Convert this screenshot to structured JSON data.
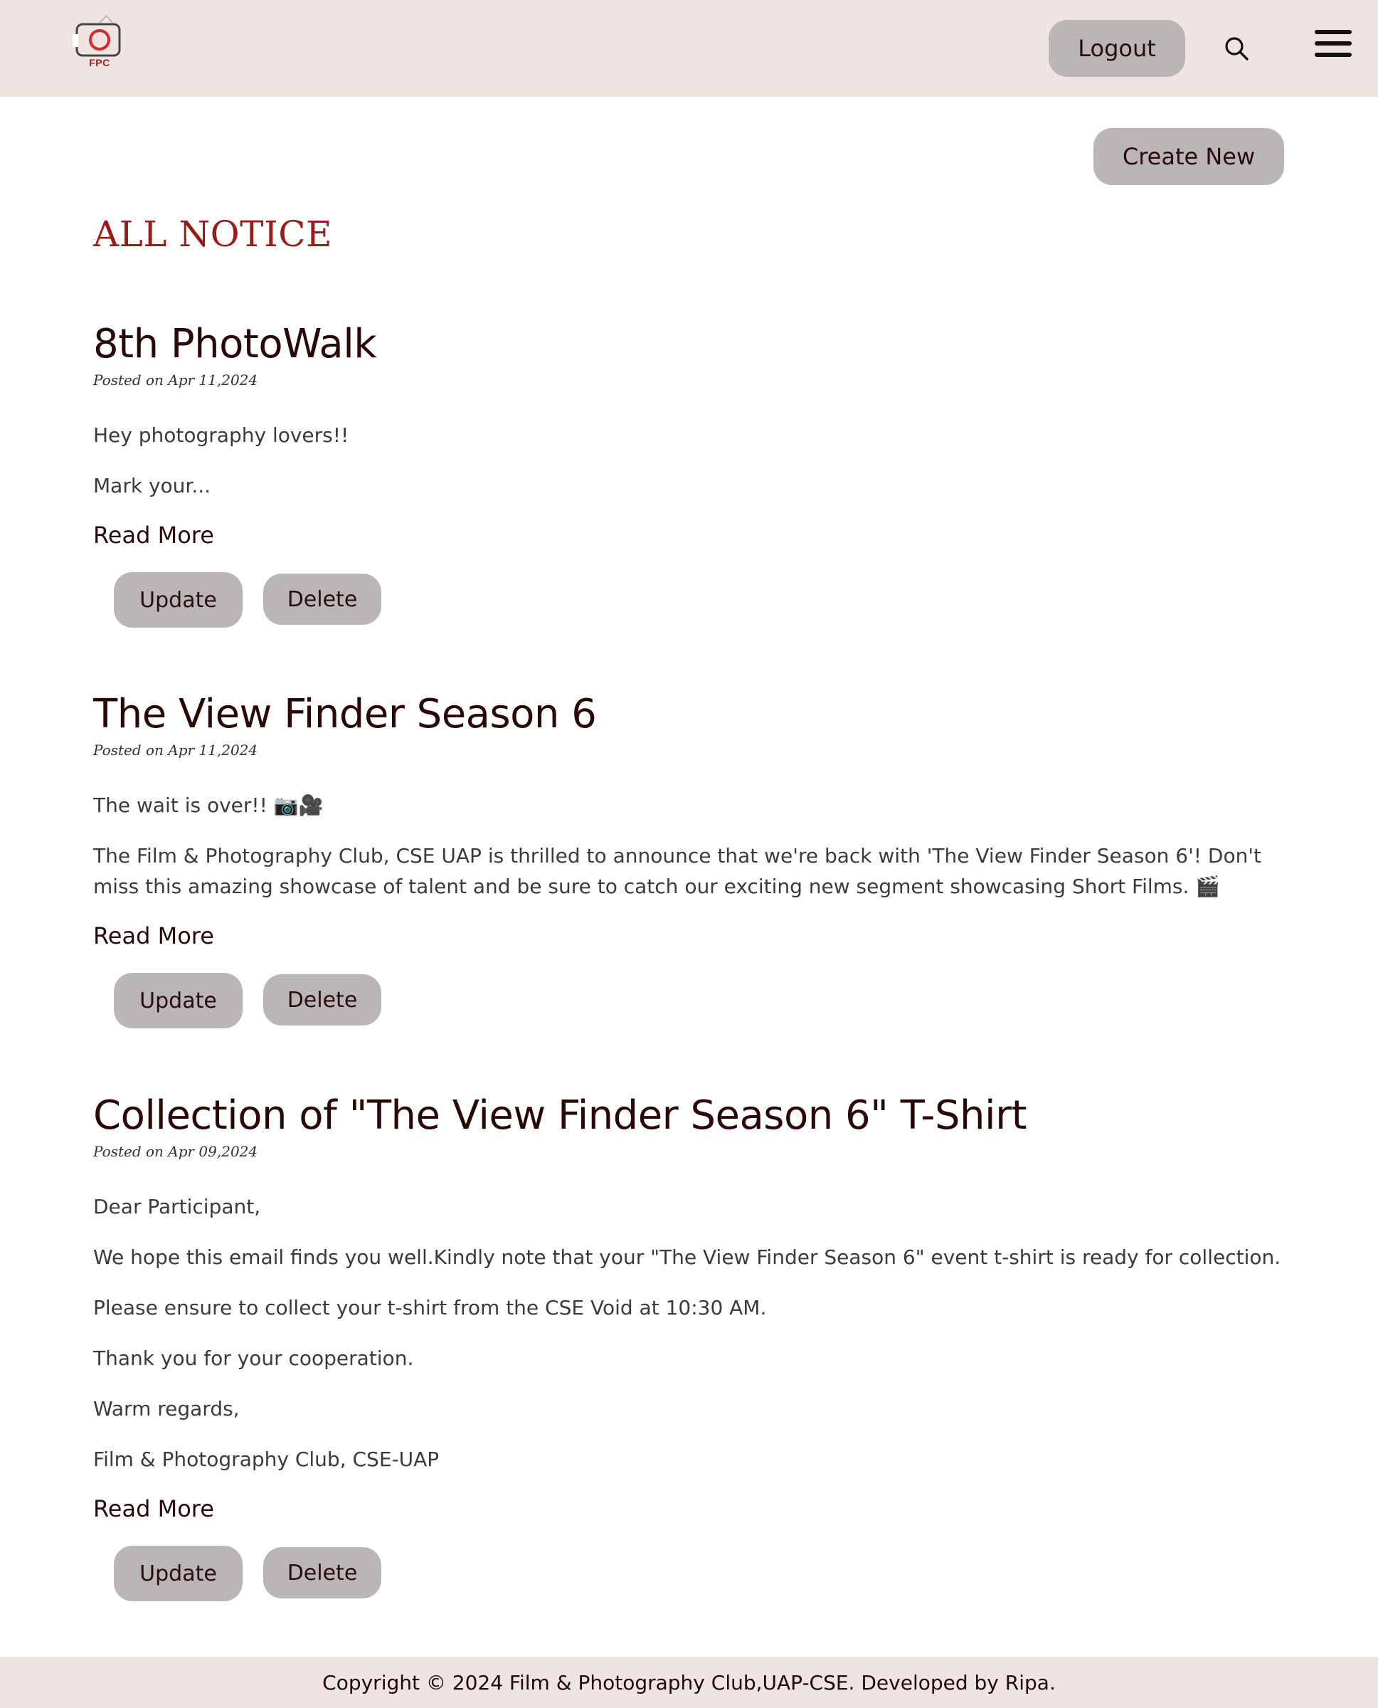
{
  "header": {
    "logo_text": "FPC",
    "logout_label": "Logout",
    "search_icon": "search-icon",
    "menu_icon": "hamburger-menu-icon"
  },
  "main": {
    "create_label": "Create New",
    "page_title": "ALL NOTICE",
    "notices": [
      {
        "title": "8th PhotoWalk",
        "date": "Posted on Apr 11,2024",
        "paragraphs": [
          "Hey photography lovers!!",
          "Mark your..."
        ],
        "read_more": "Read More",
        "update_label": "Update",
        "delete_label": "Delete"
      },
      {
        "title": "The View Finder Season 6",
        "date": "Posted on Apr 11,2024",
        "paragraphs": [
          "The wait is over!! 📷🎥",
          "The Film & Photography Club, CSE UAP is thrilled to announce that we're back with 'The View Finder Season 6'! Don't miss this amazing showcase of talent and be sure to catch our exciting new segment showcasing Short Films. 🎬"
        ],
        "read_more": "Read More",
        "update_label": "Update",
        "delete_label": "Delete"
      },
      {
        "title": "Collection of \"The View Finder Season 6\" T-Shirt",
        "date": "Posted on Apr 09,2024",
        "paragraphs": [
          "Dear Participant,",
          "We hope this email finds you well.Kindly note that your \"The View Finder Season 6\" event t-shirt is ready for collection.",
          "Please ensure to collect your t-shirt from the CSE Void at 10:30 AM.",
          "Thank you for your cooperation.",
          "Warm regards,",
          "Film & Photography Club, CSE-UAP"
        ],
        "read_more": "Read More",
        "update_label": "Update",
        "delete_label": "Delete"
      }
    ]
  },
  "footer": {
    "text": "Copyright © 2024 Film & Photography Club,UAP-CSE. Developed by Ripa."
  },
  "colors": {
    "header_bg": "#f0e4e3",
    "button_bg": "#bab6b7",
    "title_red": "#9a1b1b",
    "heading_dark": "#2a0808"
  }
}
